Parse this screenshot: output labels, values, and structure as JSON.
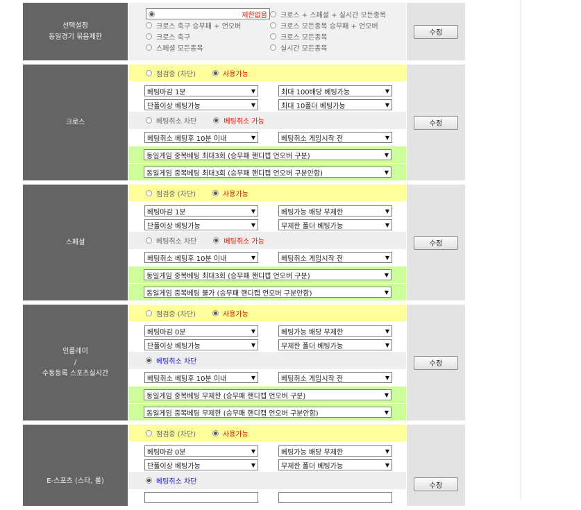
{
  "filter": {
    "label_lines": [
      "선택설정",
      "동일경기 묶음제한"
    ],
    "options": [
      [
        "제한없음",
        "크로스 + 스페셜 + 실시간 모든종목"
      ],
      [
        "크로스 축구 승무패 + 언오버",
        "크로스 모든종목 승무패 + 언오버"
      ],
      [
        "크로스 축구",
        "크로스 모든종목"
      ],
      [
        "스페셜 모든종목",
        "실시간 모든종목"
      ]
    ],
    "selected": "제한없음",
    "button": "수정"
  },
  "sections": [
    {
      "id": "cross",
      "label_lines": [
        "크로스"
      ],
      "status": {
        "off": "점검중 (차단)",
        "on": "사용가능",
        "selected": "on"
      },
      "selects_top": [
        [
          "베팅마감 1분",
          "최대 100배당 베팅가능"
        ],
        [
          "단폴이상 베팅가능",
          "최대 10폴더 베팅가능"
        ]
      ],
      "cancel": {
        "off": "베팅취소 차단",
        "on": "베팅취소 가능",
        "selected": "on"
      },
      "selects_cancel": [
        "베팅취소 베팅후 10분 이내",
        "베팅취소 게임시작 전"
      ],
      "dup": [
        "동일게임 중복베팅 최대3회 (승무패 핸디캡 언오버 구분)",
        "동일게임 중복베팅 최대3회 (승무패 핸디캡 언오버 구분안함)"
      ],
      "button": "수정"
    },
    {
      "id": "special",
      "label_lines": [
        "스페셜"
      ],
      "status": {
        "off": "점검중 (차단)",
        "on": "사용가능",
        "selected": "on"
      },
      "selects_top": [
        [
          "베팅마감 1분",
          "베팅가능 배당 무제한"
        ],
        [
          "단폴이상 베팅가능",
          "무제한 폴더 베팅가능"
        ]
      ],
      "cancel": {
        "off": "베팅취소 차단",
        "on": "베팅취소 가능",
        "selected": "on"
      },
      "selects_cancel": [
        "베팅취소 베팅후 10분 이내",
        "베팅취소 게임시작 전"
      ],
      "dup": [
        "동일게임 중복베팅 최대3회 (승무패 핸디캡 언오버 구분)",
        "동일게임 중복베팅 불가 (승무패 핸디캡 언오버 구분안함)"
      ],
      "button": "수정"
    },
    {
      "id": "inplay",
      "label_lines": [
        "인플레이",
        "/",
        "수동등록 스포츠실시간"
      ],
      "status": {
        "off": "점검중 (차단)",
        "on": "사용가능",
        "selected": "on"
      },
      "selects_top": [
        [
          "베팅마감 0분",
          "베팅가능 배당 무제한"
        ],
        [
          "단폴이상 베팅가능",
          "무제한 폴더 베팅가능"
        ]
      ],
      "cancel": {
        "off": "",
        "on": "베팅취소 차단",
        "selected": "single"
      },
      "selects_cancel": [
        "베팅취소 베팅후 10분 이내",
        "베팅취소 게임시작 전"
      ],
      "dup": [
        "동일게임 중복베팅 무제한 (승무패 핸디캡 언오버 구분)",
        "동일게임 중복베팅 무제한 (승무패 핸디캡 언오버 구분안함)"
      ],
      "button": "수정"
    },
    {
      "id": "esports",
      "label_lines": [
        "E-스포츠 (스타, 롤)"
      ],
      "status": {
        "off": "점검중 (차단)",
        "on": "사용가능",
        "selected": "on"
      },
      "selects_top": [
        [
          "베팅마감 0분",
          "베팅가능 배당 무제한"
        ],
        [
          "단폴이상 베팅가능",
          "무제한 폴더 베팅가능"
        ]
      ],
      "cancel": {
        "off": "",
        "on": "베팅취소 차단",
        "selected": "single"
      },
      "selects_cancel": [
        "",
        ""
      ],
      "dup": [],
      "button": "수정"
    }
  ]
}
